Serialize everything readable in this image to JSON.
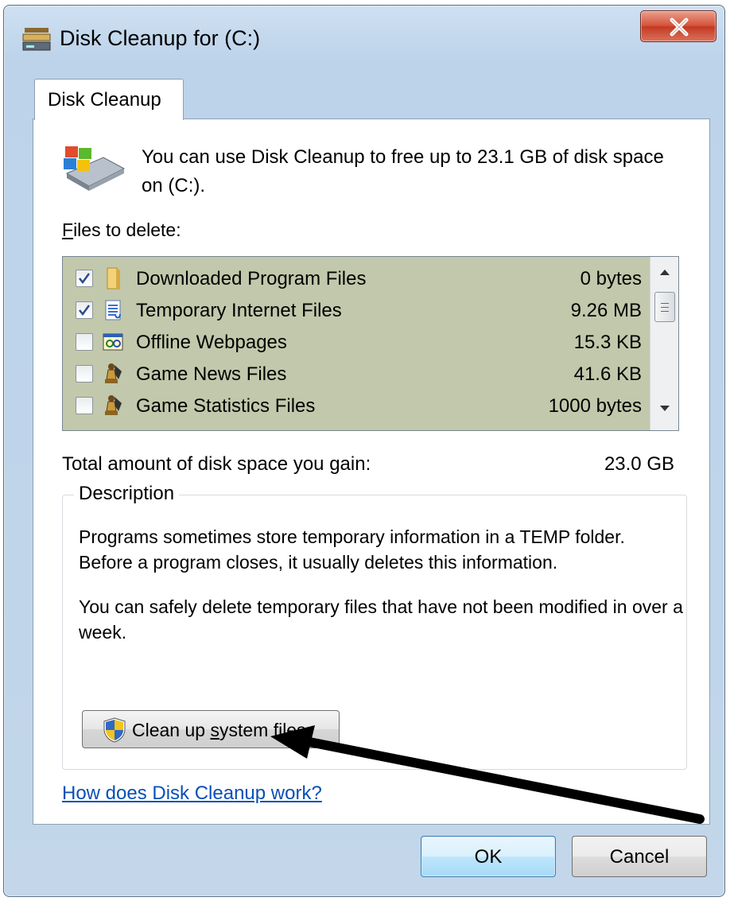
{
  "window": {
    "title": "Disk Cleanup for  (C:)",
    "close_icon": "close-icon"
  },
  "tab": {
    "label": "Disk Cleanup"
  },
  "intro": {
    "text": "You can use Disk Cleanup to free up to 23.1 GB of disk space on  (C:)."
  },
  "files": {
    "label_prefix": "F",
    "label_rest": "iles to delete:",
    "items": [
      {
        "name": "Downloaded Program Files",
        "size": "0 bytes",
        "checked": true,
        "icon": "folder-icon"
      },
      {
        "name": "Temporary Internet Files",
        "size": "9.26 MB",
        "checked": true,
        "icon": "document-icon"
      },
      {
        "name": "Offline Webpages",
        "size": "15.3 KB",
        "checked": false,
        "icon": "offline-webpages-icon"
      },
      {
        "name": "Game News Files",
        "size": "41.6 KB",
        "checked": false,
        "icon": "chess-piece-icon"
      },
      {
        "name": "Game Statistics Files",
        "size": "1000 bytes",
        "checked": false,
        "icon": "chess-piece-icon"
      }
    ]
  },
  "total": {
    "label": "Total amount of disk space you gain:",
    "value": "23.0 GB"
  },
  "description": {
    "legend": "Description",
    "paragraph1": "Programs sometimes store temporary information in a TEMP folder. Before a program closes, it usually deletes this information.",
    "paragraph2": "You can safely delete temporary files that have not been modified in over a week."
  },
  "cleanup_button": {
    "label_pre": "Clean up ",
    "label_u": "s",
    "label_post": "ystem files",
    "icon": "uac-shield-icon"
  },
  "help_link": {
    "text": "How does Disk Cleanup work?"
  },
  "buttons": {
    "ok": "OK",
    "cancel": "Cancel"
  },
  "colors": {
    "list_background": "#c2c8ab",
    "link": "#0b4fb6",
    "arrow": "#000000"
  }
}
